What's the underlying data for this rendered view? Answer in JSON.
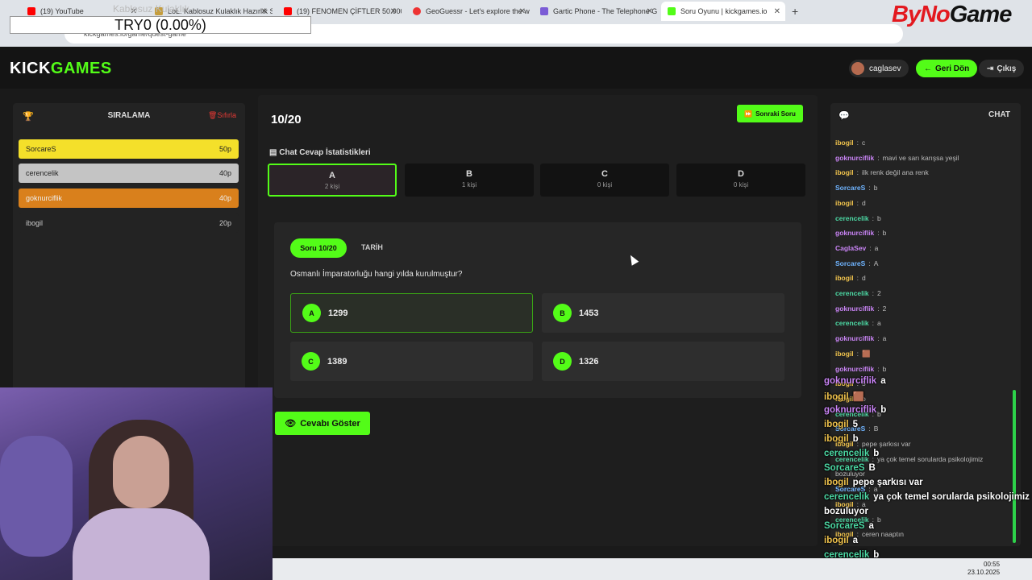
{
  "browser": {
    "tabs": [
      {
        "title": "(19) YouTube",
        "color": "#ff0000"
      },
      {
        "title": "LoL: Kablosuz Kulaklık Hazırlık Sezonu C",
        "color": "#c59d3c"
      },
      {
        "title": "(19) FENOMEN ÇİFTLER 50.000$",
        "color": "#ff0000"
      },
      {
        "title": "GeoGuessr - Let's explore the w",
        "color": "#e33"
      },
      {
        "title": "Gartic Phone - The Telephone G",
        "color": "#7b5cd6"
      },
      {
        "title": "Soru Oyunu | kickgames.io",
        "color": "#53fc18"
      }
    ],
    "address": "kickgames.io/game/quest-game"
  },
  "stream_overlay": {
    "label": "TRY0 (0.00%)",
    "top_text": "Kablosuz Kulaklık",
    "brand_a": "ByNo",
    "brand_b": "Game"
  },
  "header": {
    "logo_a": "KICK",
    "logo_b": "GAMES",
    "user": "caglasev",
    "back": "Geri Dön",
    "logout": "Çıkış"
  },
  "ranking": {
    "title": "SIRALAMA",
    "reset": "Sıfırla",
    "rows": [
      {
        "name": "SorcareS",
        "points": "50p"
      },
      {
        "name": "cerencelik",
        "points": "40p"
      },
      {
        "name": "goknurciflik",
        "points": "40p"
      },
      {
        "name": "ibogil",
        "points": "20p"
      }
    ]
  },
  "game": {
    "progress": "10/20",
    "next_button": "Sonraki Soru",
    "stats_title": "Chat Cevap İstatistikleri",
    "stats": [
      {
        "letter": "A",
        "count": "2 kişi"
      },
      {
        "letter": "B",
        "count": "1 kişi"
      },
      {
        "letter": "C",
        "count": "0 kişi"
      },
      {
        "letter": "D",
        "count": "0 kişi"
      }
    ],
    "question_pill": "Soru 10/20",
    "category": "TARİH",
    "question": "Osmanlı İmparatorluğu hangi yılda kurulmuştur?",
    "options": [
      {
        "letter": "A",
        "text": "1299"
      },
      {
        "letter": "B",
        "text": "1453"
      },
      {
        "letter": "C",
        "text": "1389"
      },
      {
        "letter": "D",
        "text": "1326"
      }
    ],
    "show_answer": "Cevabı Göster"
  },
  "chat": {
    "title": "CHAT",
    "messages": [
      {
        "user": "ibogil",
        "text": "c"
      },
      {
        "user": "goknurciflik",
        "text": "mavi ve sarı karışsa yeşil"
      },
      {
        "user": "ibogil",
        "text": "ilk renk değil ana renk"
      },
      {
        "user": "SorcareS",
        "text": "b"
      },
      {
        "user": "ibogil",
        "text": "d"
      },
      {
        "user": "cerencelik",
        "text": "b"
      },
      {
        "user": "goknurciflik",
        "text": "b"
      },
      {
        "user": "CaglaSev",
        "text": "a"
      },
      {
        "user": "SorcareS",
        "text": "A"
      },
      {
        "user": "ibogil",
        "text": "d"
      },
      {
        "user": "cerencelik",
        "text": "2"
      },
      {
        "user": "goknurciflik",
        "text": "2"
      },
      {
        "user": "cerencelik",
        "text": "a"
      },
      {
        "user": "goknurciflik",
        "text": "a"
      },
      {
        "user": "ibogil",
        "text": "🟫"
      },
      {
        "user": "goknurciflik",
        "text": "b"
      },
      {
        "user": "ibogil",
        "text": "5"
      },
      {
        "user": "ibogil",
        "text": "b"
      },
      {
        "user": "cerencelik",
        "text": "b"
      },
      {
        "user": "SorcareS",
        "text": "B"
      },
      {
        "user": "ibogil",
        "text": "pepe şarkısı var"
      },
      {
        "user": "cerencelik",
        "text": "ya çok temel sorularda psikolojimiz"
      },
      {
        "user": "",
        "text": "bozuluyor"
      },
      {
        "user": "SorcareS",
        "text": "a"
      },
      {
        "user": "ibogil",
        "text": "a"
      },
      {
        "user": "cerencelik",
        "text": "b"
      },
      {
        "user": "ibogil",
        "text": "ceren naaptın"
      }
    ]
  },
  "overlay_chat": [
    {
      "user": "goknurciflik",
      "text": "a"
    },
    {
      "user": "ibogil",
      "text": "🟫"
    },
    {
      "user": "goknurciflik",
      "text": "b"
    },
    {
      "user": "ibogil",
      "text": "5"
    },
    {
      "user": "ibogil",
      "text": "b"
    },
    {
      "user": "cerencelik",
      "text": "b"
    },
    {
      "user": "SorcareS",
      "text": "B"
    },
    {
      "user": "ibogil",
      "text": "pepe şarkısı var"
    },
    {
      "user": "cerencelik",
      "text": "ya çok temel sorularda psikolojimiz"
    },
    {
      "user": "",
      "text": "bozuluyor"
    },
    {
      "user": "SorcareS",
      "text": "a"
    },
    {
      "user": "ibogil",
      "text": "a"
    },
    {
      "user": "cerencelik",
      "text": "b"
    },
    {
      "user": "ibogil",
      "text": "ceren naaptın"
    }
  ],
  "taskbar": {
    "time": "00:55",
    "date": "23.10.2025"
  }
}
